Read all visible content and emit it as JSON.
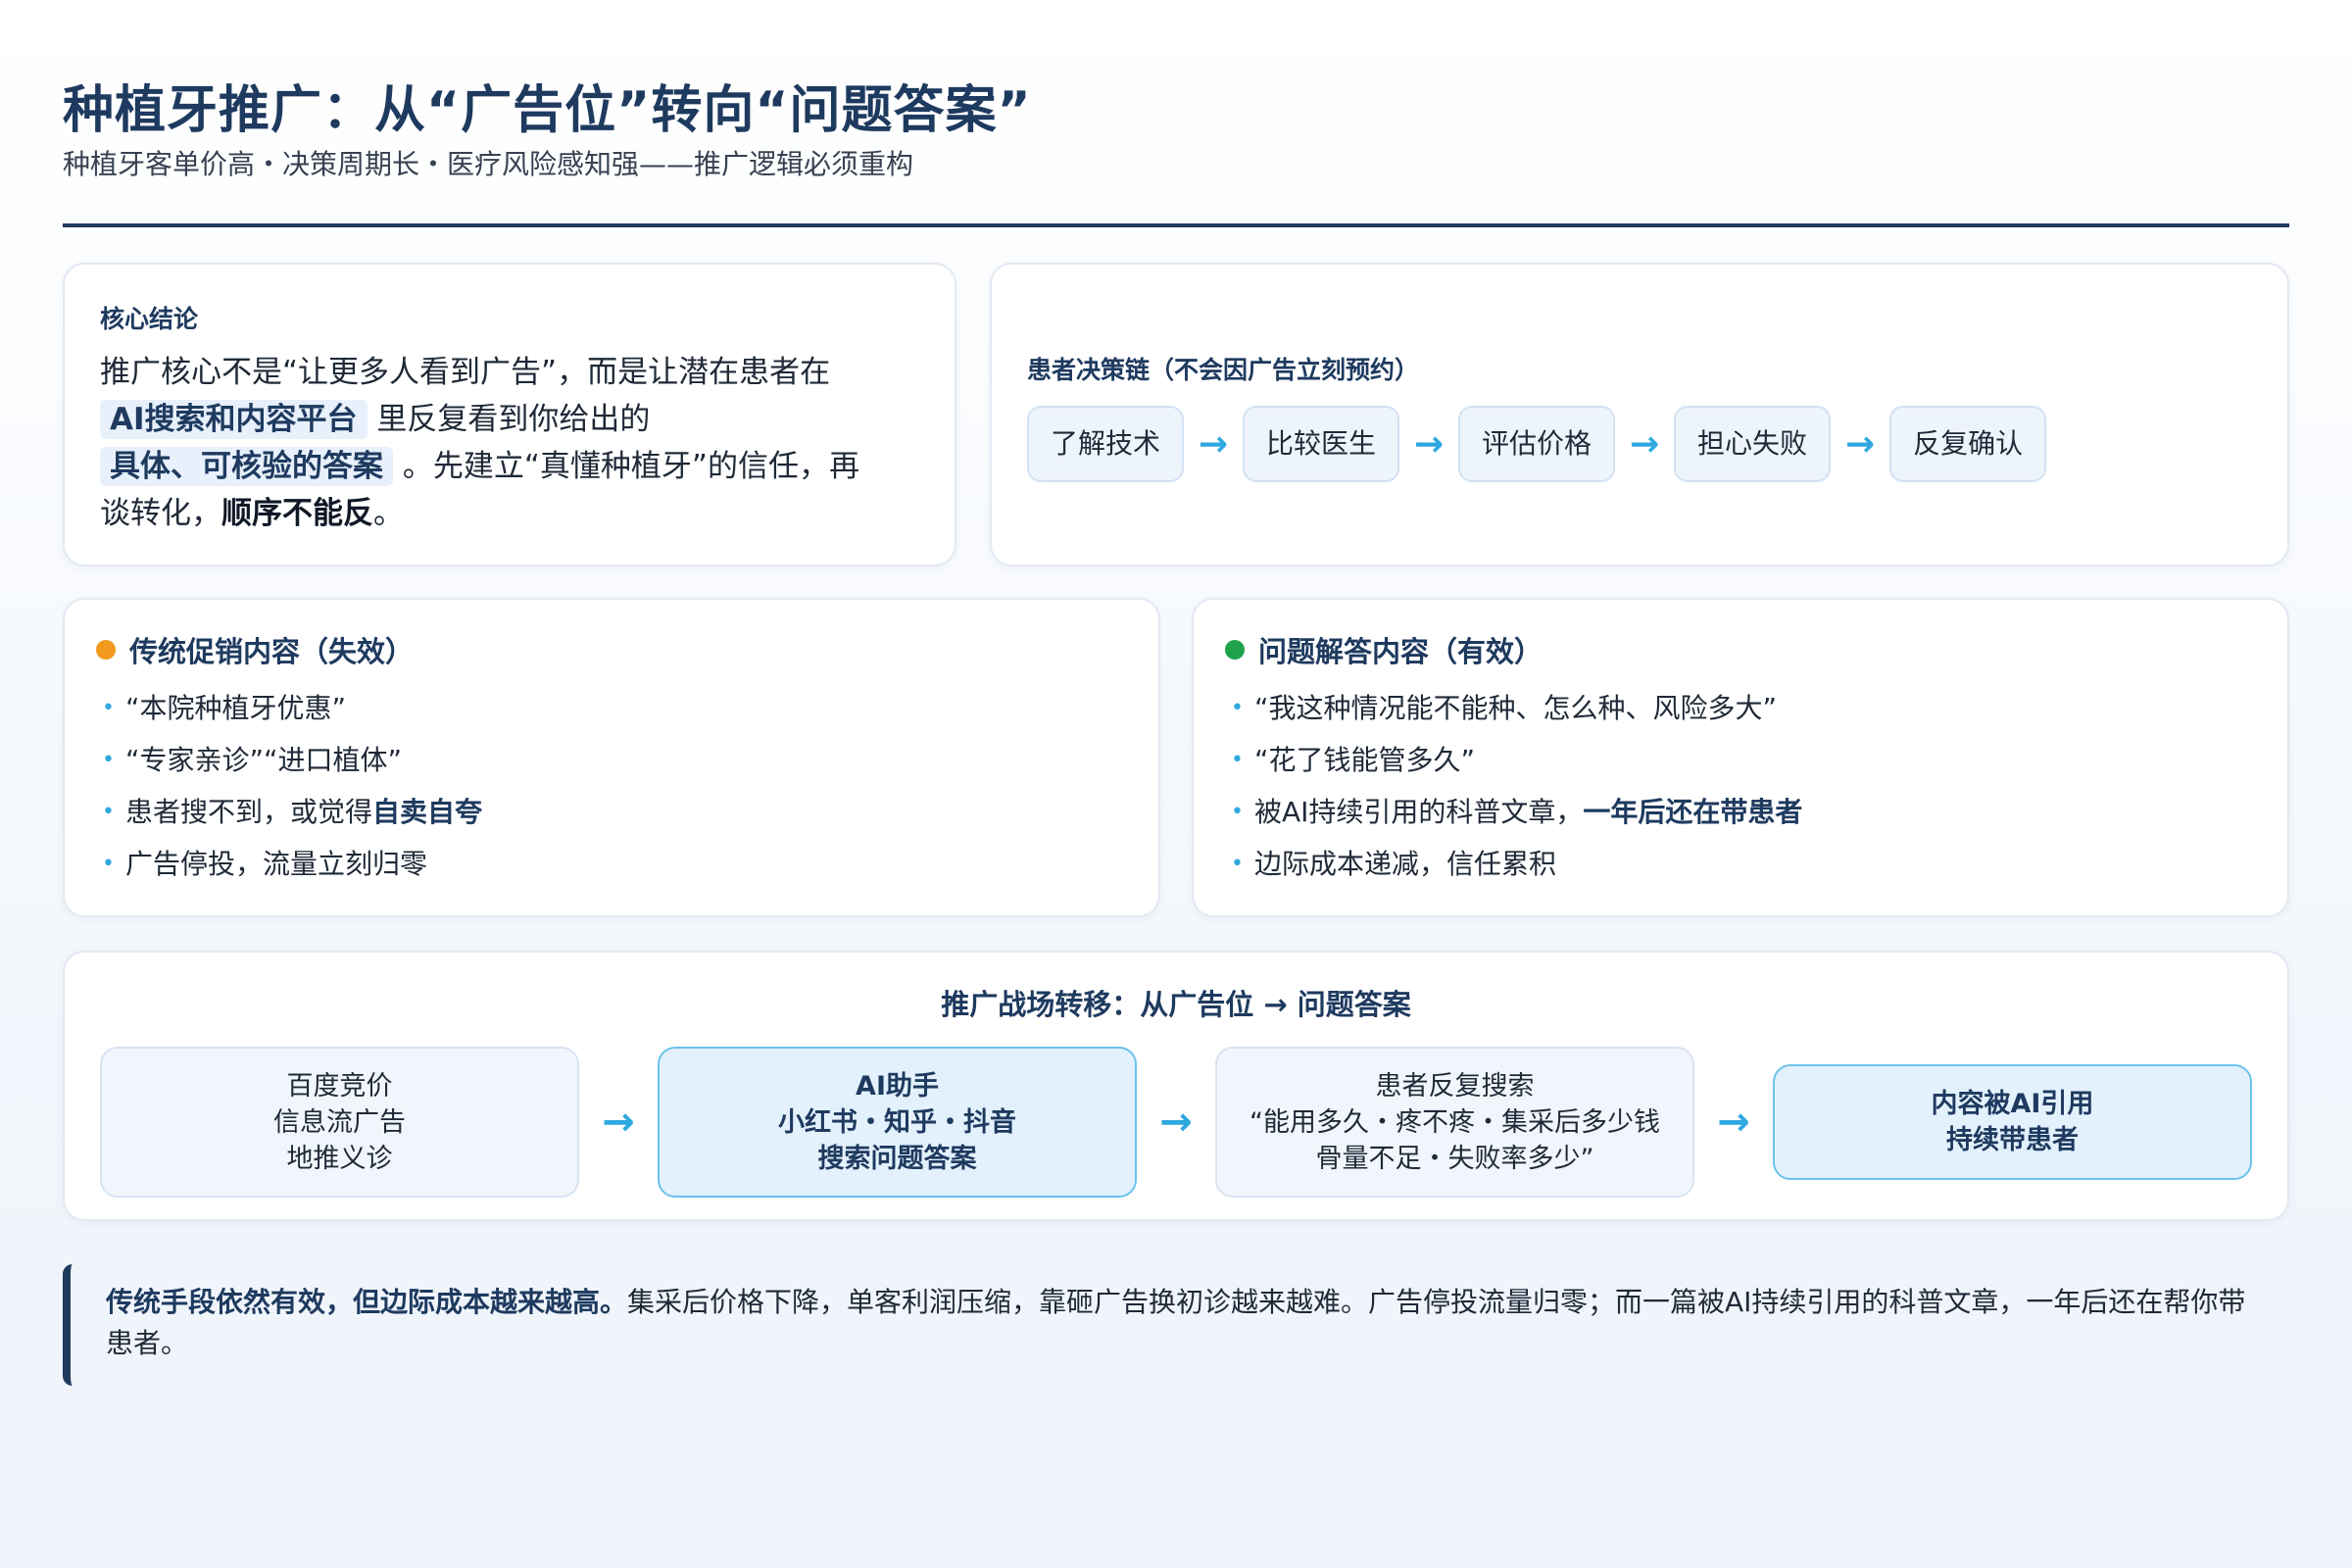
{
  "header": {
    "title": "种植牙推广：从“广告位”转向“问题答案”",
    "subtitle": "种植牙客单价高・决策周期长・医疗风险感知强——推广逻辑必须重构"
  },
  "core": {
    "label": "核心结论",
    "text_1": "推广核心不是“让更多人看到广告”，而是让潜在患者在",
    "highlight_1": "AI搜索和内容平台",
    "text_2": "里反复看到你给出的",
    "highlight_2": "具体、可核验的答案",
    "text_3": "。先建立“真懂种植牙”的信任，再谈转化，",
    "strong": "顺序不能反",
    "text_4": "。"
  },
  "chain": {
    "label": "患者决策链（不会因广告立刻预约）",
    "steps": [
      "了解技术",
      "比较医生",
      "评估价格",
      "担心失败",
      "反复确认"
    ]
  },
  "old_content": {
    "title": "传统促销内容（失效）",
    "dot_color": "#f29a1e",
    "items": [
      {
        "text": "“本院种植牙优惠”"
      },
      {
        "text": "“专家亲诊”“进口植体”"
      },
      {
        "text": "患者搜不到，或觉得",
        "strong": "自卖自夸"
      },
      {
        "text": "广告停投，流量立刻归零"
      }
    ]
  },
  "new_content": {
    "title": "问题解答内容（有效）",
    "dot_color": "#1fa34a",
    "items": [
      {
        "text": "“我这种情况能不能种、怎么种、风险多大”"
      },
      {
        "text": "“花了钱能管多久”"
      },
      {
        "text": "被AI持续引用的科普文章，",
        "strong": "一年后还在带患者"
      },
      {
        "text": "边际成本递减，信任累积"
      }
    ]
  },
  "flow": {
    "title": "推广战场转移：从广告位 → 问题答案",
    "boxes": [
      {
        "lines": [
          "百度竞价",
          "信息流广告",
          "地推义诊"
        ]
      },
      {
        "lines": [
          "AI助手",
          "小红书・知乎・抖音",
          "搜索问题答案"
        ]
      },
      {
        "lines": [
          "患者反复搜索",
          "“能用多久・疼不疼・集采后多少钱",
          "骨量不足・失败率多少”"
        ]
      },
      {
        "lines": [
          "内容被AI引用",
          "持续带患者"
        ]
      }
    ]
  },
  "note": {
    "lead": "传统手段依然有效，但边际成本越来越高。",
    "body": "集采后价格下降，单客利润压缩，靠砸广告换初诊越来越难。广告停投流量归零；而一篇被AI持续引用的科普文章，一年后还在帮你带患者。"
  },
  "colors": {
    "navy": "#1e3a5f",
    "accent_blue": "#2fa8e0",
    "highlight_bg": "#e7f0fb"
  }
}
